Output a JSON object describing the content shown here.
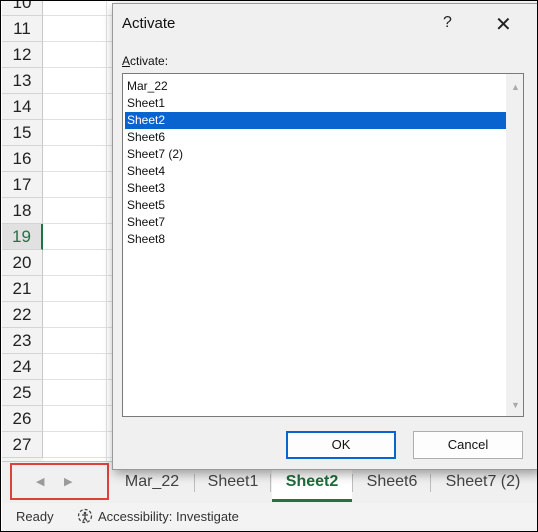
{
  "sheet": {
    "rows": [
      "10",
      "11",
      "12",
      "13",
      "14",
      "15",
      "16",
      "17",
      "18",
      "19",
      "20",
      "21",
      "22",
      "23",
      "24",
      "25",
      "26",
      "27"
    ],
    "selected_row": "19"
  },
  "tabs": [
    "Mar_22",
    "Sheet1",
    "Sheet2",
    "Sheet6",
    "Sheet7 (2)"
  ],
  "active_tab": "Sheet2",
  "status": {
    "ready": "Ready",
    "accessibility": "Accessibility: Investigate"
  },
  "dialog": {
    "title": "Activate",
    "help": "?",
    "close": "✕",
    "list_label_first": "A",
    "list_label_rest": "ctivate:",
    "items": [
      "Mar_22",
      "Sheet1",
      "Sheet2",
      "Sheet6",
      "Sheet7 (2)",
      "Sheet4",
      "Sheet3",
      "Sheet5",
      "Sheet7",
      "Sheet8"
    ],
    "selected_item": "Sheet2",
    "ok_label": "OK",
    "cancel_label": "Cancel"
  },
  "icons": {
    "prev": "◀",
    "next": "▶",
    "scroll_up": "▲",
    "scroll_down": "▼"
  }
}
